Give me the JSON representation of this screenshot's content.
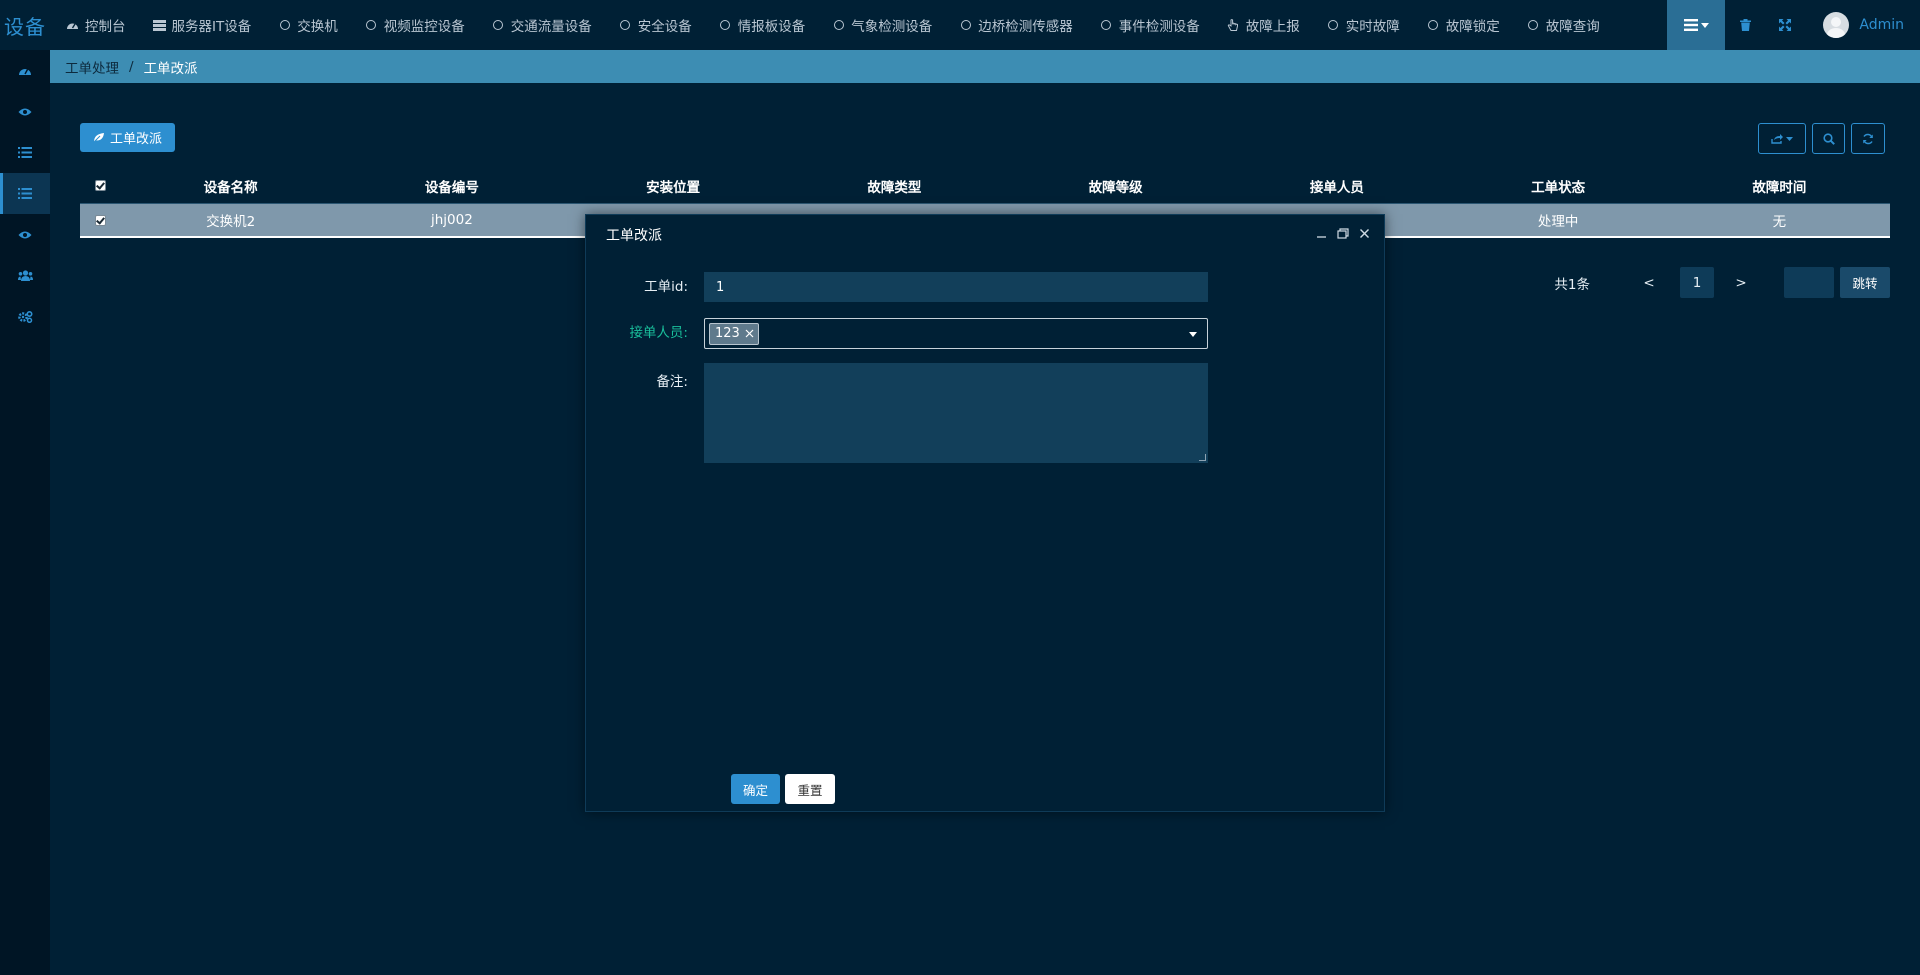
{
  "app": {
    "logo_text": "设备"
  },
  "nav": {
    "items": [
      {
        "label": "控制台",
        "icon": "dashboard-icon"
      },
      {
        "label": "服务器IT设备",
        "icon": "server-icon"
      },
      {
        "label": "交换机",
        "icon": "circle-icon"
      },
      {
        "label": "视频监控设备",
        "icon": "circle-icon"
      },
      {
        "label": "交通流量设备",
        "icon": "circle-icon"
      },
      {
        "label": "安全设备",
        "icon": "circle-icon"
      },
      {
        "label": "情报板设备",
        "icon": "circle-icon"
      },
      {
        "label": "气象检测设备",
        "icon": "circle-icon"
      },
      {
        "label": "边桥检测传感器",
        "icon": "circle-icon"
      },
      {
        "label": "事件检测设备",
        "icon": "circle-icon"
      },
      {
        "label": "故障上报",
        "icon": "hand-pointer-icon"
      },
      {
        "label": "实时故障",
        "icon": "circle-icon"
      },
      {
        "label": "故障锁定",
        "icon": "circle-icon"
      },
      {
        "label": "故障查询",
        "icon": "circle-icon"
      }
    ],
    "user_name": "Admin"
  },
  "breadcrumb": {
    "parent": "工单处理",
    "separator": "/",
    "current": "工单改派"
  },
  "toolbar": {
    "reassign_label": "工单改派"
  },
  "table": {
    "columns": [
      "设备名称",
      "设备编号",
      "安装位置",
      "故障类型",
      "故障等级",
      "接单人员",
      "工单状态",
      "故障时间"
    ],
    "rows": [
      {
        "cells": [
          "交换机2",
          "jhj002",
          "",
          "",
          "",
          "",
          "处理中",
          "无"
        ]
      }
    ]
  },
  "pagination": {
    "total": "共1条",
    "prev": "<",
    "current_page": "1",
    "next": ">",
    "jump_label": "跳转"
  },
  "modal": {
    "title": "工单改派",
    "fields": {
      "order_id_label": "工单id:",
      "order_id_value": "1",
      "assignee_label": "接单人员:",
      "assignee_tag": "123",
      "remark_label": "备注:"
    },
    "confirm_label": "确定",
    "reset_label": "重置"
  },
  "colors": {
    "accent": "#2d8fd0",
    "breadcrumb_bg": "#3d8db3",
    "page_bg": "#002035",
    "required_label": "#19be9b"
  }
}
